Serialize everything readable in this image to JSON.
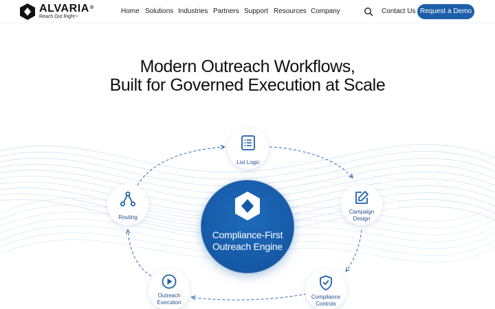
{
  "brand": {
    "name": "ALVARIA",
    "registered": "®",
    "tagline": "Reach Out Right",
    "tagline_mark": "™"
  },
  "nav": {
    "items": [
      {
        "label": "Home"
      },
      {
        "label": "Solutions"
      },
      {
        "label": "Industries"
      },
      {
        "label": "Partners"
      },
      {
        "label": "Support"
      },
      {
        "label": "Resources"
      },
      {
        "label": "Company"
      }
    ],
    "search_icon": "search-icon",
    "contact_label": "Contact Us",
    "demo_label": "Request a Demo"
  },
  "hero": {
    "title_line1": "Modern Outreach Workflows,",
    "title_line2": "Built for Governed Execution at Scale"
  },
  "diagram": {
    "center": {
      "line1": "Compliance-First",
      "line2": "Outreach Engine",
      "icon": "diamond-icon"
    },
    "nodes": [
      {
        "label_line1": "List Logic",
        "label_line2": "",
        "icon": "list-icon"
      },
      {
        "label_line1": "Campaign",
        "label_line2": "Design",
        "icon": "edit-icon"
      },
      {
        "label_line1": "Compliance",
        "label_line2": "Controls",
        "icon": "shield-check-icon"
      },
      {
        "label_line1": "Outreach",
        "label_line2": "Execution",
        "icon": "play-icon"
      },
      {
        "label_line1": "Routing",
        "label_line2": "",
        "icon": "routing-icon"
      }
    ]
  },
  "colors": {
    "accent": "#1d5ea8",
    "core": "#1559a6",
    "node_text": "#1d4f8c",
    "wave": "#c9dcf0"
  }
}
